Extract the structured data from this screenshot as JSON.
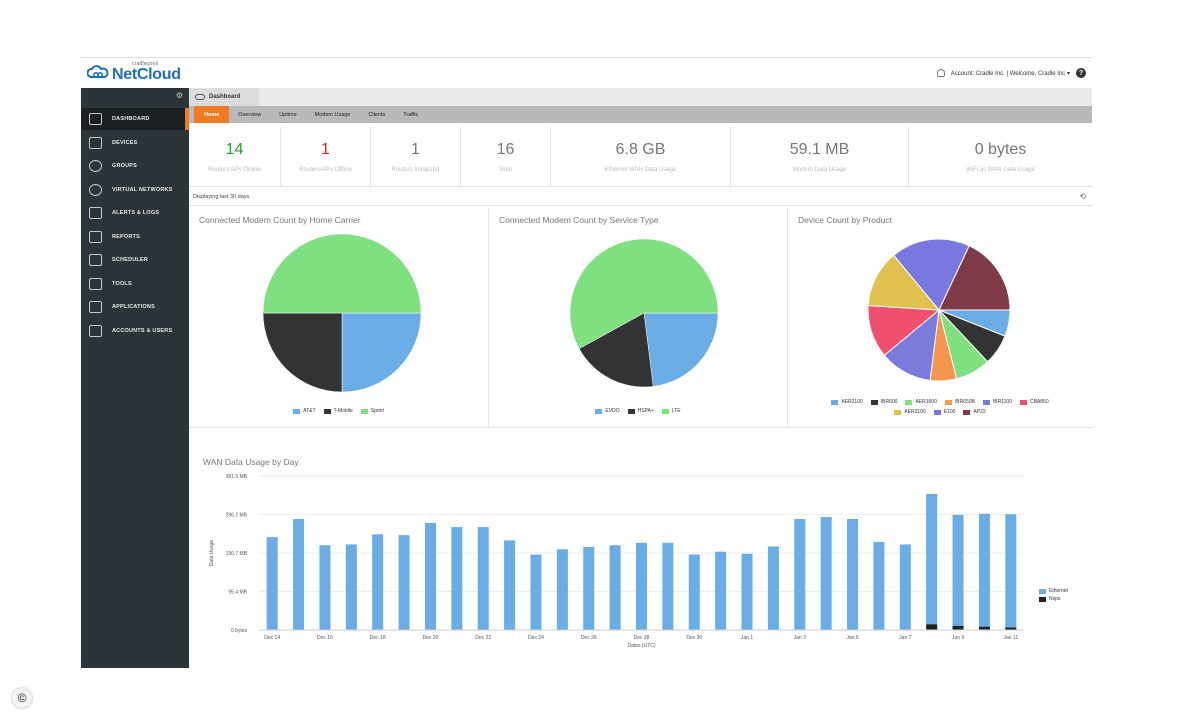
{
  "app": {
    "brand_small": "cradlepoint",
    "brand_name": "NetCloud",
    "account_text": "Account: Cradle Inc. | Welcome, Cradle Inc ▾"
  },
  "sidebar": {
    "items": [
      {
        "label": "DASHBOARD",
        "icon": "dashboard-icon",
        "active": true
      },
      {
        "label": "DEVICES",
        "icon": "devices-icon"
      },
      {
        "label": "GROUPS",
        "icon": "groups-icon"
      },
      {
        "label": "VIRTUAL NETWORKS",
        "icon": "globe-icon"
      },
      {
        "label": "ALERTS & LOGS",
        "icon": "alerts-icon"
      },
      {
        "label": "REPORTS",
        "icon": "reports-icon"
      },
      {
        "label": "SCHEDULER",
        "icon": "scheduler-icon"
      },
      {
        "label": "TOOLS",
        "icon": "tools-icon"
      },
      {
        "label": "APPLICATIONS",
        "icon": "applications-icon"
      },
      {
        "label": "ACCOUNTS & USERS",
        "icon": "users-icon"
      }
    ]
  },
  "breadcrumb": {
    "label": "Dashboard"
  },
  "tabs": [
    "Home",
    "Overview",
    "Uptime",
    "Modem Usage",
    "Clients",
    "Traffic"
  ],
  "stats": [
    {
      "value": "14",
      "label": "Routers/APs Online",
      "color": "#2ca02c"
    },
    {
      "value": "1",
      "label": "Routers/APs Offline",
      "color": "#d62728"
    },
    {
      "value": "1",
      "label": "Routers Initialized",
      "color": "#777777"
    },
    {
      "value": "16",
      "label": "Total",
      "color": "#777777"
    },
    {
      "value": "6.8 GB",
      "label": "Ethernet WAN Data Usage",
      "color": "#777777"
    },
    {
      "value": "59.1 MB",
      "label": "Modem Data Usage",
      "color": "#777777"
    },
    {
      "value": "0 bytes",
      "label": "WiFi as WAN Data Usage",
      "color": "#777777"
    }
  ],
  "range_text": "Displaying last 30 days",
  "chart_data": [
    {
      "type": "pie",
      "title": "Connected Modem Count by Home Carrier",
      "labels": [
        "AT&T",
        "T-Mobile",
        "Sprint"
      ],
      "values": [
        25,
        25,
        50
      ],
      "colors": [
        "#6aace6",
        "#333333",
        "#7ee07e"
      ]
    },
    {
      "type": "pie",
      "title": "Connected Modem Count by Service Type",
      "labels": [
        "EVDO",
        "HSPA+",
        "LTE"
      ],
      "values": [
        23,
        19,
        58
      ],
      "colors": [
        "#6aace6",
        "#333333",
        "#7ee07e"
      ]
    },
    {
      "type": "pie",
      "title": "Device Count by Product",
      "labels": [
        "AER2100",
        "IBR600",
        "AER1600",
        "IBR650B",
        "IBR1100",
        "CBA850",
        "AER3100",
        "E100",
        "AP22"
      ],
      "values": [
        6,
        7,
        8,
        6,
        12,
        12,
        13,
        18,
        18
      ],
      "colors": [
        "#6aace6",
        "#333333",
        "#7ee07e",
        "#f49550",
        "#7b7bdc",
        "#f04f6f",
        "#e0c04f",
        "#7878e0",
        "#7e3a46"
      ]
    },
    {
      "type": "bar",
      "title": "WAN Data Usage by Day",
      "xlabel": "Dates (UTC)",
      "ylabel": "Data Usage",
      "ytick_labels": [
        "0 bytes",
        "95.4 MB",
        "190.7 MB",
        "286.1 MB",
        "381.5 MB"
      ],
      "ylim": [
        0,
        381.5
      ],
      "xtick_labels": [
        "Dec 14",
        "Dec 16",
        "Dec 18",
        "Dec 20",
        "Dec 22",
        "Dec 24",
        "Dec 26",
        "Dec 28",
        "Dec 30",
        "Jan 1",
        "Jan 3",
        "Jan 5",
        "Jan 7",
        "Jan 9",
        "Jan 11"
      ],
      "series": [
        {
          "name": "Ethernet",
          "color": "#6aace6",
          "values": [
            230,
            275,
            210,
            212,
            237,
            235,
            265,
            255,
            255,
            222,
            187,
            200,
            206,
            210,
            216,
            216,
            187,
            194,
            189,
            207,
            275,
            280,
            275,
            218,
            212,
            337,
            285,
            288,
            287
          ]
        },
        {
          "name": "Nsps",
          "color": "#222222",
          "values": [
            0,
            0,
            0,
            0,
            0,
            0,
            0,
            0,
            0,
            0,
            0,
            0,
            0,
            0,
            0,
            0,
            0,
            0,
            0,
            0,
            0,
            0,
            0,
            0,
            0,
            14,
            10,
            8,
            6
          ]
        }
      ]
    }
  ]
}
